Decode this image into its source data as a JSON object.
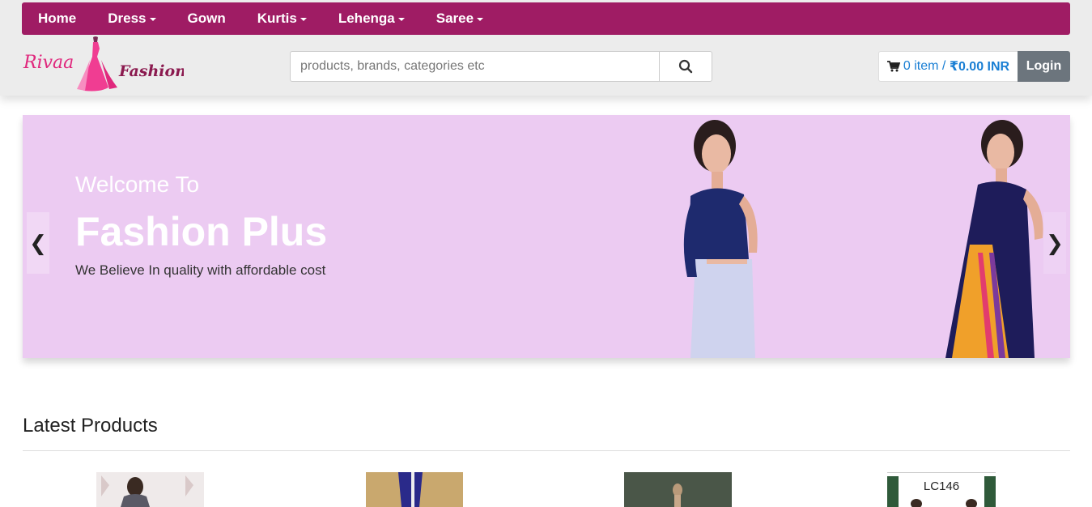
{
  "nav": {
    "items": [
      {
        "label": "Home",
        "dropdown": false
      },
      {
        "label": "Dress",
        "dropdown": true
      },
      {
        "label": "Gown",
        "dropdown": false
      },
      {
        "label": "Kurtis",
        "dropdown": true
      },
      {
        "label": "Lehenga",
        "dropdown": true
      },
      {
        "label": "Saree",
        "dropdown": true
      }
    ],
    "bg_color": "#9f1c64"
  },
  "logo": {
    "text_left": "Rivaa",
    "text_right": "Fashion",
    "color": "#e0287d"
  },
  "search": {
    "placeholder": "products, brands, categories etc",
    "icon": "search-icon"
  },
  "cart": {
    "count_label": "0 item",
    "separator": " / ",
    "total": "₹0.00 INR",
    "icon": "cart-icon",
    "color": "#1a7fd4"
  },
  "login": {
    "label": "Login"
  },
  "banner": {
    "welcome": "Welcome To",
    "title": "Fashion Plus",
    "tagline": "We Believe In quality with affordable cost",
    "prev": "❮",
    "next": "❯",
    "bg_color": "#eccbf2"
  },
  "latest": {
    "title": "Latest Products",
    "items": [
      {
        "label": ""
      },
      {
        "label": ""
      },
      {
        "label": ""
      },
      {
        "label": "LC146"
      }
    ]
  }
}
